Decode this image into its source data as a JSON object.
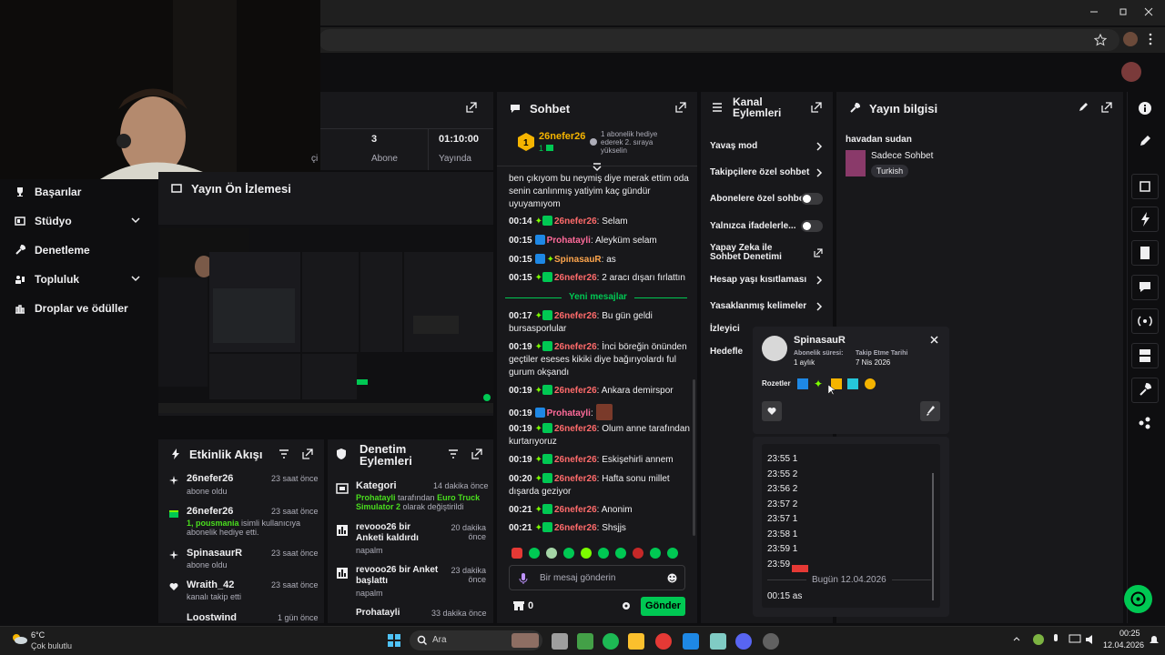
{
  "colors": {
    "accent": "#00c853",
    "bg": "#0e0e10",
    "panel": "#18181b"
  },
  "sidebar": {
    "items": [
      {
        "label": "Başarılar",
        "icon": "trophy-icon"
      },
      {
        "label": "Stüdyo",
        "icon": "studio-icon"
      },
      {
        "label": "Denetleme",
        "icon": "wrench-icon"
      },
      {
        "label": "Topluluk",
        "icon": "community-icon"
      },
      {
        "label": "Droplar ve ödüller",
        "icon": "drops-icon"
      }
    ]
  },
  "stats": {
    "subs_value": "3",
    "subs_label": "Abone",
    "uptime_value": "01:10:00",
    "uptime_label": "Yayında",
    "partial_label": "çi"
  },
  "preview": {
    "title": "Yayın Ön İzlemesi"
  },
  "activity": {
    "title": "Etkinlik Akışı",
    "items": [
      {
        "user": "26nefer26",
        "time": "23 saat önce",
        "text": "abone oldu"
      },
      {
        "user": "26nefer26",
        "time": "23 saat önce",
        "text_a": "1, pousmania",
        "text_b": " isimli kullanıcıya abonelik hediye etti."
      },
      {
        "user": "SpinasaurR",
        "time": "23 saat önce",
        "text": "abone oldu"
      },
      {
        "user": "Wraith_42",
        "time": "23 saat önce",
        "text": "kanalı takip etti"
      },
      {
        "user": "Loostwind",
        "time": "1 gün önce",
        "text": ""
      }
    ]
  },
  "modactions": {
    "title": "Denetim Eylemleri",
    "items": [
      {
        "title": "Kategori",
        "time": "14 dakika önce",
        "a": "Prohatayli",
        "b": " tarafından ",
        "c": "Euro Truck Simulator 2",
        "d": " olarak değiştirildi"
      },
      {
        "title": "revooo26 bir Anketi kaldırdı",
        "time": "20 dakika önce",
        "sub": "napalm"
      },
      {
        "title": "revooo26 bir Anket başlattı",
        "time": "23 dakika önce",
        "sub": "napalm"
      },
      {
        "title": "Prohatayli",
        "time": "33 dakika önce",
        "sub": ""
      }
    ]
  },
  "chat": {
    "title": "Sohbet",
    "pinned_user": "26nefer26",
    "pinned_count": "1",
    "hype": "1 abonelik hediye ederek 2. sıraya yükselin",
    "intro": "ben çıkıyom bu neymiş diye merak ettim oda senin canlınmış yatiyim kaç gündür uyuyamıyom",
    "lines": [
      {
        "time": "00:14",
        "user": "26nefer26",
        "msg": "Selam"
      },
      {
        "time": "00:15",
        "user": "Prohatayli",
        "msg": "Aleyküm selam"
      },
      {
        "time": "00:15",
        "user": "SpinasauR",
        "msg": "as"
      },
      {
        "time": "00:15",
        "user": "26nefer26",
        "msg": "2 aracı dışarı fırlattın"
      },
      {
        "time": "00:17",
        "user": "26nefer26",
        "msg": "Bu gün geldi bursasporlular"
      },
      {
        "time": "00:19",
        "user": "26nefer26",
        "msg": "İnci böreğin önünden geçtiler eseses kikiki diye bağırıyolardı ful gurum okşandı"
      },
      {
        "time": "00:19",
        "user": "26nefer26",
        "msg": "Ankara demirspor"
      },
      {
        "time": "00:19",
        "user": "Prohatayli",
        "msg": ""
      },
      {
        "time": "00:19",
        "user": "26nefer26",
        "msg": "Olum anne tarafından kurtarıyoruz"
      },
      {
        "time": "00:19",
        "user": "26nefer26",
        "msg": "Eskişehirli annem"
      },
      {
        "time": "00:20",
        "user": "26nefer26",
        "msg": "Hafta sonu millet dışarda geziyor"
      },
      {
        "time": "00:21",
        "user": "26nefer26",
        "msg": "Anonim"
      },
      {
        "time": "00:21",
        "user": "26nefer26",
        "msg": "Shsjjs"
      }
    ],
    "new_messages": "Yeni mesajlar",
    "placeholder": "Bir mesaj gönderin",
    "points": "0",
    "send": "Gönder"
  },
  "channel": {
    "title_a": "Kanal",
    "title_b": "Eylemleri",
    "items": [
      "Yavaş mod",
      "Takipçilere özel sohbet",
      "Abonelere özel sohbet",
      "Yalnızca ifadelerle...",
      "Yapay Zeka ile Sohbet Denetimi",
      "Hesap yaşı kısıtlaması",
      "Yasaklanmış kelimeler",
      "İzleyici",
      "Hedefle"
    ]
  },
  "streaminfo": {
    "title": "Yayın bilgisi",
    "stream_title": "havadan sudan",
    "category": "Sadece Sohbet",
    "tag": "Turkish"
  },
  "usercard": {
    "name": "SpinasauR",
    "sub_label": "Abonelik süresi:",
    "sub_value": "1 aylık",
    "follow_label": "Takip Etme Tarihi",
    "follow_value": "7 Nis 2026",
    "badges_label": "Rozetler"
  },
  "userlog": {
    "lines": [
      "23:55 1",
      "23:55 2",
      "23:56 2",
      "23:57 2",
      "23:57 1",
      "23:58 1",
      "23:59 1",
      "23:59"
    ],
    "divider": "Bugün 12.04.2026",
    "last": "00:15 as"
  },
  "taskbar": {
    "temp": "6°C",
    "weather": "Çok bulutlu",
    "search": "Ara",
    "time": "00:25",
    "date": "12.04.2026"
  }
}
